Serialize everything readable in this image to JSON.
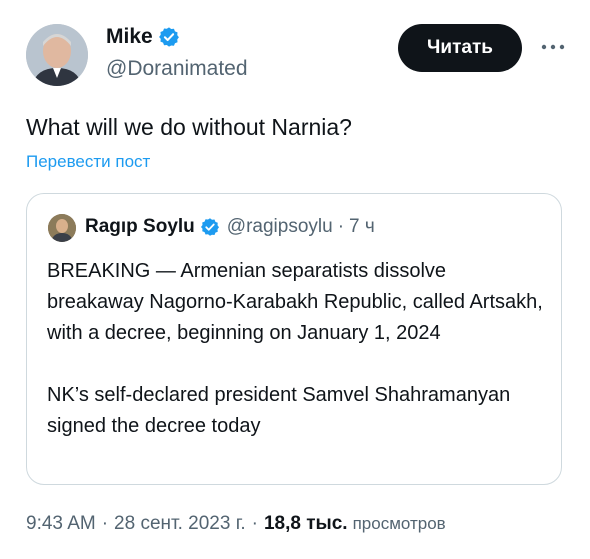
{
  "tweet": {
    "author": {
      "name": "Mike",
      "handle": "@Doranimated"
    },
    "follow_label": "Читать",
    "text": "What will we do without Narnia?",
    "translate_label": "Перевести пост",
    "quote": {
      "author_name": "Ragıp Soylu",
      "author_handle": "@ragipsoylu",
      "separator": "·",
      "time": "7 ч",
      "paragraph1": "BREAKING — Armenian separatists dissolve breakaway Nagorno-Karabakh Republic, called Artsakh, with a decree, beginning on January 1, 2024",
      "paragraph2": "NK’s self-declared president Samvel Shahramanyan signed the decree today"
    },
    "meta": {
      "time": "9:43 AM",
      "date": "28 сент. 2023 г.",
      "separator": "·",
      "views_count": "18,8 тыс.",
      "views_label": "просмотров"
    }
  },
  "icons": {
    "verified": "verified-badge-icon",
    "more": "more-horizontal-icon"
  },
  "colors": {
    "accent": "#1d9bf0",
    "text_primary": "#0f1419",
    "text_secondary": "#536471",
    "border": "#cfd9de",
    "button_bg": "#0f1419"
  }
}
